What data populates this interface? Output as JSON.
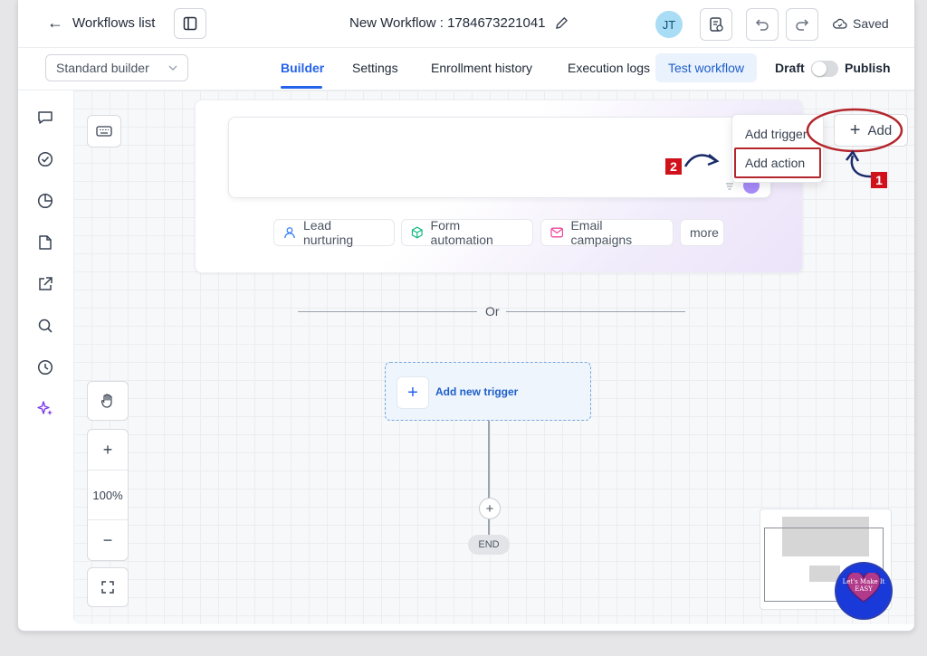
{
  "header": {
    "back_label": "Workflows list",
    "title": "New Workflow : 1784673221041",
    "avatar_initials": "JT",
    "save_status": "Saved"
  },
  "nav": {
    "builder_select_value": "Standard builder",
    "tabs": [
      {
        "label": "Builder",
        "active": true
      },
      {
        "label": "Settings"
      },
      {
        "label": "Enrollment history"
      },
      {
        "label": "Execution logs"
      }
    ],
    "test_button": "Test workflow",
    "draft_label": "Draft",
    "publish_label": "Publish"
  },
  "sidebar": {
    "icons": [
      "chat-icon",
      "check-circle-icon",
      "pie-chart-icon",
      "document-icon",
      "external-link-icon",
      "search-icon",
      "history-icon",
      "sparkles-icon"
    ]
  },
  "canvas": {
    "chips": [
      {
        "label": "Lead nurturing",
        "icon": "user-icon",
        "color": "#3b82f6"
      },
      {
        "label": "Form automation",
        "icon": "cube-icon",
        "color": "#10b981"
      },
      {
        "label": "Email campaigns",
        "icon": "mail-icon",
        "color": "#ec4899"
      },
      {
        "label": "more"
      }
    ],
    "divider_text": "Or",
    "add_trigger_label": "Add new trigger",
    "end_label": "END",
    "zoom_level": "100%",
    "zoom_in": "+",
    "zoom_out": "−"
  },
  "add_menu": {
    "button_label": "Add",
    "items": [
      "Add trigger",
      "Add action"
    ]
  },
  "annotations": {
    "step_1": "1",
    "step_2": "2",
    "highlight_color": "#b3262c"
  },
  "watermark": {
    "text": "Let's Make It EASY"
  }
}
